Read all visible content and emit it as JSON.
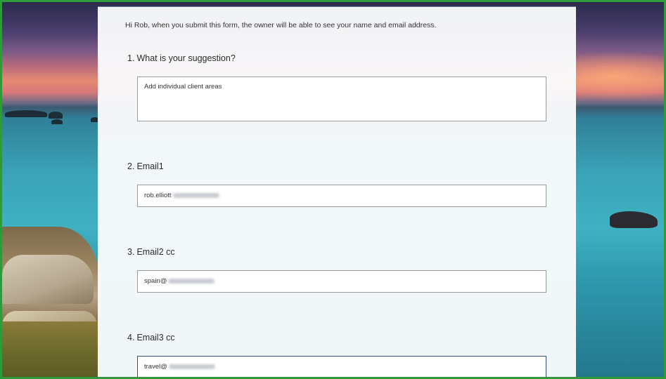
{
  "form": {
    "intro": "Hi Rob, when you submit this form, the owner will be able to see your name and email address.",
    "questions": [
      {
        "number": "1.",
        "label": "What is your suggestion?",
        "value": "Add individual client areas"
      },
      {
        "number": "2.",
        "label": "Email1",
        "value": "rob.elliott"
      },
      {
        "number": "3.",
        "label": "Email2 cc",
        "value": "spain@"
      },
      {
        "number": "4.",
        "label": "Email3 cc",
        "value": "travel@"
      }
    ]
  },
  "colors": {
    "frame": "#2e9a3a",
    "focus_border": "#2c4f7c",
    "input_border": "#9a9a9a"
  }
}
